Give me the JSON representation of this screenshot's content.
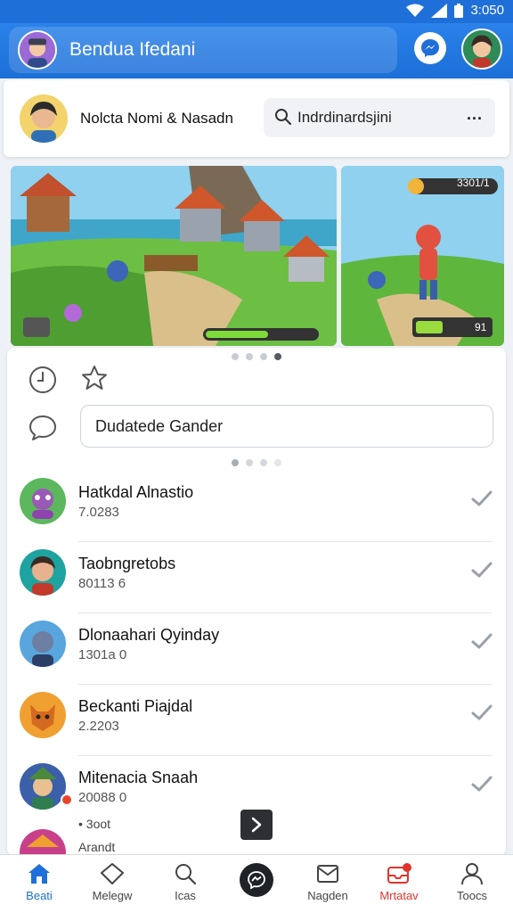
{
  "status_bar": {
    "time": "3:050"
  },
  "header": {
    "title": "Bendua Ifedani"
  },
  "profile": {
    "name": "Nolcta Nomi & Nasadn",
    "search_value": "Indrdinardsjini",
    "more_label": "..."
  },
  "carousel": {
    "dots": 4,
    "active_dot": 3,
    "slide2_score": "3301/1",
    "slide2_badge": "91"
  },
  "composer": {
    "input_value": "Dudatede Gander",
    "dots": 4,
    "active_dot": 0
  },
  "chats": [
    {
      "name": "Hatkdal Alnastio",
      "sub": "7.0283",
      "avatar_color": "#5cb85c"
    },
    {
      "name": "Taobngretobs",
      "sub": "80113 6",
      "avatar_color": "#1fa3a0"
    },
    {
      "name": "Dlonaahari Qyinday",
      "sub": "1301a 0",
      "avatar_color": "#58a6dd"
    },
    {
      "name": "Beckanti Piajdal",
      "sub": "2.2203",
      "avatar_color": "#f0a030"
    },
    {
      "name": "Mitenacia Snaah",
      "sub": "20088 0",
      "avatar_color": "#3b5fa8"
    }
  ],
  "partial": {
    "line1": "• 3oot",
    "line2": "Arandt"
  },
  "nav": [
    {
      "label": "Beati",
      "icon": "home-icon"
    },
    {
      "label": "Melegw",
      "icon": "diamond-icon"
    },
    {
      "label": "Icas",
      "icon": "search-icon"
    },
    {
      "label": "",
      "icon": "center-action-icon"
    },
    {
      "label": "Nagden",
      "icon": "mail-icon"
    },
    {
      "label": "Mrtatav",
      "icon": "inbox-alert-icon"
    },
    {
      "label": "Toocs",
      "icon": "person-icon"
    }
  ],
  "colors": {
    "primary": "#1f6fd8",
    "alert": "#e0352b"
  }
}
